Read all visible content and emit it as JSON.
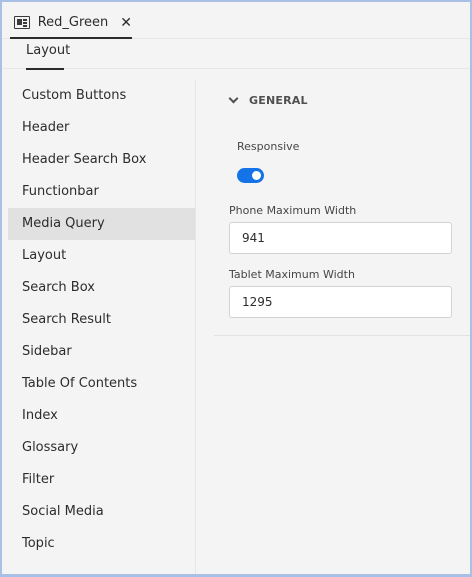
{
  "tab": {
    "title": "Red_Green",
    "close_glyph": "✕",
    "icon": "document-panel-icon"
  },
  "subtabs": [
    "Layout"
  ],
  "sidebar": {
    "items": [
      {
        "label": "Custom Buttons"
      },
      {
        "label": "Header"
      },
      {
        "label": "Header Search Box"
      },
      {
        "label": "Functionbar"
      },
      {
        "label": "Media Query",
        "selected": true
      },
      {
        "label": "Layout"
      },
      {
        "label": "Search Box"
      },
      {
        "label": "Search Result"
      },
      {
        "label": "Sidebar"
      },
      {
        "label": "Table Of Contents"
      },
      {
        "label": "Index"
      },
      {
        "label": "Glossary"
      },
      {
        "label": "Filter"
      },
      {
        "label": "Social Media"
      },
      {
        "label": "Topic"
      }
    ]
  },
  "general": {
    "title": "GENERAL",
    "responsive_label": "Responsive",
    "responsive_on": true,
    "phone_label": "Phone Maximum Width",
    "phone_value": "941",
    "tablet_label": "Tablet Maximum Width",
    "tablet_value": "1295"
  },
  "colors": {
    "accent": "#1473e6",
    "selected_bg": "#e1e1e1",
    "frame": "#a9bfe6"
  }
}
